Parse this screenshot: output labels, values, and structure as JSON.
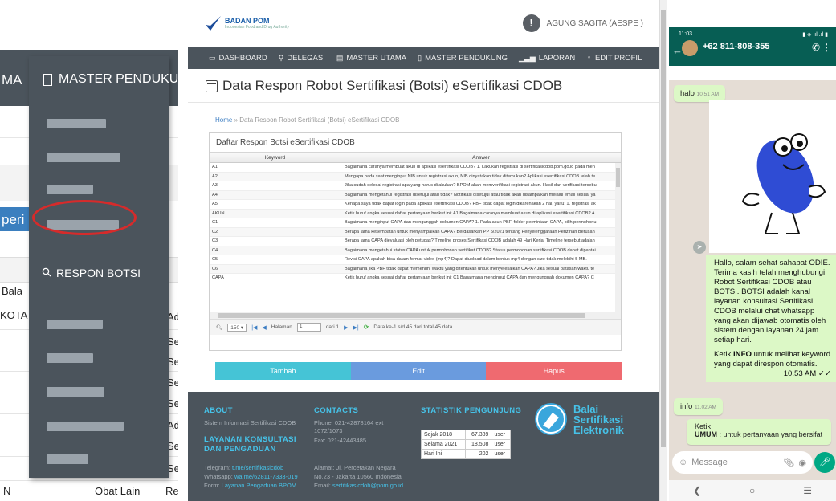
{
  "left": {
    "nav_partial": "MA",
    "menu_title": "MASTER PENDUKUNG",
    "menu_active_item": "RESPON BOTSI",
    "section_partial": "peri",
    "table_header_partial": "Bala",
    "cells": [
      "KOTA",
      "Ad",
      "Se",
      "Se",
      "Se",
      "Se",
      "Ad",
      "Se",
      "Se",
      "N",
      "Obat Lain",
      "Re"
    ],
    "highlight_color": "#d62b2b"
  },
  "mid": {
    "logo": {
      "name": "BADAN POM",
      "tagline": "Indonesian Food and Drug Authority"
    },
    "user_initial": "!",
    "user_name": "AGUNG SAGITA (AESPE )",
    "nav": [
      {
        "icon": "monitor-icon",
        "glyph": "▭",
        "label": "DASHBOARD"
      },
      {
        "icon": "key-icon",
        "glyph": "⚲",
        "label": "DELEGASI"
      },
      {
        "icon": "book-icon",
        "glyph": "▤",
        "label": "MASTER UTAMA"
      },
      {
        "icon": "document-icon",
        "glyph": "▯",
        "label": "MASTER PENDUKUNG"
      },
      {
        "icon": "chart-icon",
        "glyph": "▁▃▅",
        "label": "LAPORAN"
      },
      {
        "icon": "user-icon",
        "glyph": "♀",
        "label": "EDIT PROFIL"
      }
    ],
    "page_title": "Data Respon Robot Sertifikasi (Botsi) eSertifikasi CDOB",
    "breadcrumb": {
      "home": "Home",
      "sep": "»",
      "current": "Data Respon Robot Sertifikasi (Botsi) eSertifikasi CDOB"
    },
    "grid": {
      "title": "Daftar Respon Botsi eSertifikasi CDOB",
      "col_keyword": "Keyword",
      "col_answer": "Answer",
      "rows": [
        {
          "k": "A1",
          "a": "Bagaimana caranya membuat akun di aplikasi esertifikasi CDOB? 1. Lakukan registrasi di sertifikasicdob.pom.go.id pada men"
        },
        {
          "k": "A2",
          "a": "Mengapa pada saat menginput NIB untuk registrasi akun, NIB dinyatakan tidak ditemukan? Aplikasi esertifikasi CDOB telah te"
        },
        {
          "k": "A3",
          "a": "Jika sudah selesai registrasi apa yang harus dilakukan? BPOM akan memverifikasi registrasi akun. Hasil dari verifikasi tersebu"
        },
        {
          "k": "A4",
          "a": "Bagaimana mengetahui registrasi disetujui atau tidak? Notifikasi disetujui atau tidak akan disampaikan melalui email sesuai ya"
        },
        {
          "k": "A5",
          "a": "Kenapa saya tidak dapat login pada aplikasi esertifikasi CDOB? PBF tidak dapat login dikarenakan 2 hal, yaitu: 1. registrasi ak"
        },
        {
          "k": "AKUN",
          "a": "Ketik huruf angka sesuai daftar pertanyaan berikut ini: A1 Bagaimana caranya membuat akun di aplikasi esertifikasi CDOB? A"
        },
        {
          "k": "C1",
          "a": "Bagaimana menginput CAPA dan mengunggah dokumen CAPA? 1. Pada akun PBF, folder permintaan CAPA, pilih permohonu"
        },
        {
          "k": "C2",
          "a": "Berapa lama kesempatan untuk menyampaikan CAPA? Berdasarkan PP 5/2021 tentang Penyelenggaraan Perizinan Berusah"
        },
        {
          "k": "C3",
          "a": "Berapa lama CAPA dievaluasi oleh petugas? Timeline proses Sertifikasi CDOB adalah 49 Hari Kerja. Timeline tersebut adalah"
        },
        {
          "k": "C4",
          "a": "Bagaimana mengetahui status CAPA untuk permohonan sertifikat CDOB? Status permohonan sertifikasi CDOB dapat dipantai"
        },
        {
          "k": "C5",
          "a": "Revisi CAPA apakah bisa dalam format video (mp4)? Dapat diupload dalam bentuk mp4 dengan size tidak melebihi 5 MB."
        },
        {
          "k": "C6",
          "a": "Bagaimana jika PBF tidak dapat memenuhi waktu yang ditentukan untuk menyelesaikan CAPA? Jika sesuai batasan waktu te"
        },
        {
          "k": "CAPA",
          "a": "Ketik huruf angka sesuai daftar pertanyaan berikut ini: C1 Bagaimana menginput CAPA dan mengunggah dokumen CAPA? C"
        }
      ],
      "pager": {
        "per_page": "150",
        "page_label": "Halaman",
        "page_value": "1",
        "of_label": "dari 1",
        "summary": "Data ke-1 s/d 45 dari total 45 data"
      }
    },
    "buttons": {
      "add": "Tambah",
      "edit": "Edit",
      "delete": "Hapus"
    },
    "footer": {
      "about_title": "ABOUT",
      "about_text": "Sistem Informasi Sertifikasi CDOB",
      "layanan_title_1": "LAYANAN KONSULTASI",
      "layanan_title_2": "DAN PENGADUAN",
      "telegram_label": "Telegram:",
      "telegram": "t.me/sertifikasicdob",
      "whatsapp_label": "Whatsapp:",
      "whatsapp": "wa.me/62811-7333-019",
      "form_label": "Form:",
      "form": "Layanan Pengaduan BPOM",
      "contacts_title": "CONTACTS",
      "phone_1": "Phone: 021-42878164 ext",
      "phone_2": "1072/1073",
      "fax": "Fax: 021-42443485",
      "address_1": "Alamat: Jl. Percetakan Negara",
      "address_2": "No.23 - Jakarta 10560 Indonesia",
      "email_label": "Email:",
      "email": "sertifikasicdob@pom.go.id",
      "stat_title": "STATISTIK PENGUNJUNG",
      "stats": [
        {
          "label": "Sejak 2018",
          "value": "67.389",
          "unit": "user"
        },
        {
          "label": "Selama 2021",
          "value": "18.508",
          "unit": "user"
        },
        {
          "label": "Hari Ini",
          "value": "202",
          "unit": "user"
        }
      ],
      "bse_1": "Balai",
      "bse_2": "Sertifikasi",
      "bse_3": "Elektronik"
    }
  },
  "phone": {
    "status_time": "11:03",
    "status_right": "▮ ◈ .ıl .ıl ▮",
    "contact": "+62 811-808-355",
    "msg_halo": "halo",
    "msg_halo_time": "10.51 AM",
    "bot_message": [
      "Hallo, salam sehat sahabat ODIE.",
      "Terima kasih telah menghubungi Robot Sertifikasi CDOB atau BOTSI. BOTSI adalah kanal layanan konsultasi Sertifikasi CDOB melalui chat whatsapp yang akan dijawab otomatis oleh sistem dengan layanan 24 jam setiap hari."
    ],
    "bot_hint_prefix": "Ketik ",
    "bot_hint_bold": "INFO",
    "bot_hint_suffix": " untuk melihat keyword yang dapat direspon otomatis.",
    "bot_time": "10.53 AM ✓✓",
    "msg_info": "info",
    "msg_info_time": "11.02 AM",
    "reply_1": "Ketik",
    "reply_2_bold": "UMUM",
    "reply_2": " : untuk pertanyaan yang bersifat",
    "input_placeholder": "Message",
    "accent": "#075e54"
  }
}
